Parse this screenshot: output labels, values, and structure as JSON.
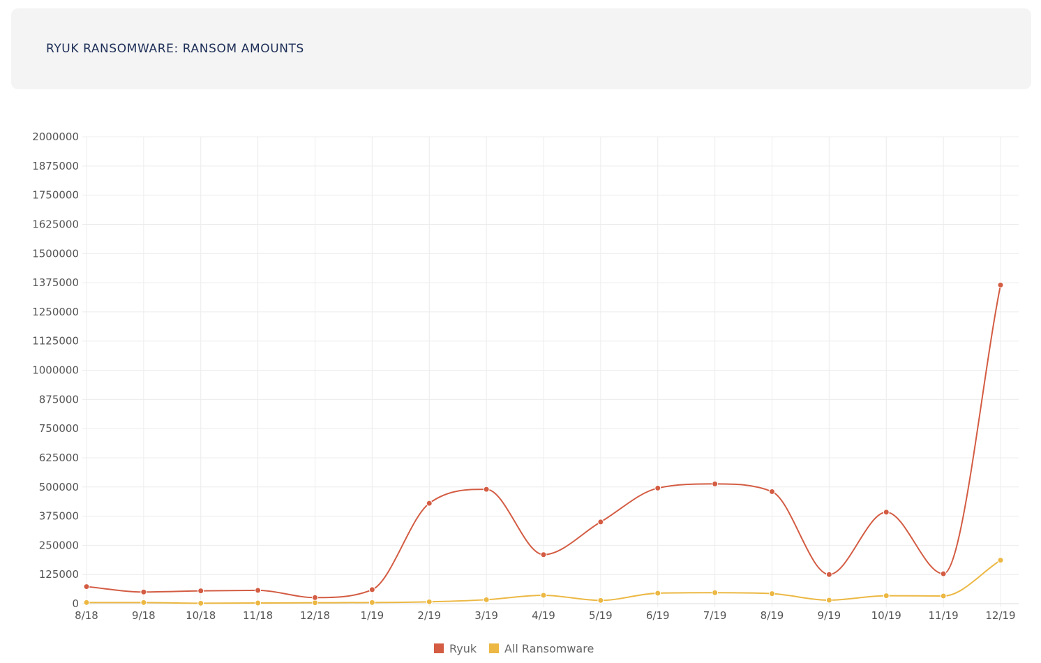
{
  "header": {
    "title": "RYUK RANSOMWARE: RANSOM AMOUNTS"
  },
  "colors": {
    "ryuk": "#d35c43",
    "all_ransomware": "#ecb843",
    "grid": "#ececec",
    "header_bg": "#f4f4f4",
    "title": "#1d2e57"
  },
  "chart_data": {
    "type": "line",
    "title": "RYUK RANSOMWARE: RANSOM AMOUNTS",
    "xlabel": "",
    "ylabel": "",
    "categories": [
      "8/18",
      "9/18",
      "10/18",
      "11/18",
      "12/18",
      "1/19",
      "2/19",
      "3/19",
      "4/19",
      "5/19",
      "6/19",
      "7/19",
      "8/19",
      "9/19",
      "10/19",
      "11/19",
      "12/19"
    ],
    "ylim": [
      0,
      2000000
    ],
    "yticks": [
      0,
      125000,
      250000,
      375000,
      500000,
      625000,
      750000,
      875000,
      1000000,
      1125000,
      1250000,
      1375000,
      1500000,
      1625000,
      1750000,
      1875000,
      2000000
    ],
    "grid": true,
    "legend_position": "bottom",
    "series": [
      {
        "name": "Ryuk",
        "color": "#d35c43",
        "values": [
          73000,
          50000,
          55000,
          57000,
          26000,
          60000,
          430000,
          490000,
          210000,
          350000,
          495000,
          513000,
          480000,
          125000,
          392000,
          128000,
          1365000
        ]
      },
      {
        "name": "All Ransomware",
        "color": "#ecb843",
        "values": [
          5000,
          5000,
          2000,
          3000,
          4000,
          5000,
          8000,
          17000,
          36000,
          14000,
          45000,
          47000,
          43000,
          15000,
          34000,
          33000,
          186000
        ]
      }
    ]
  }
}
